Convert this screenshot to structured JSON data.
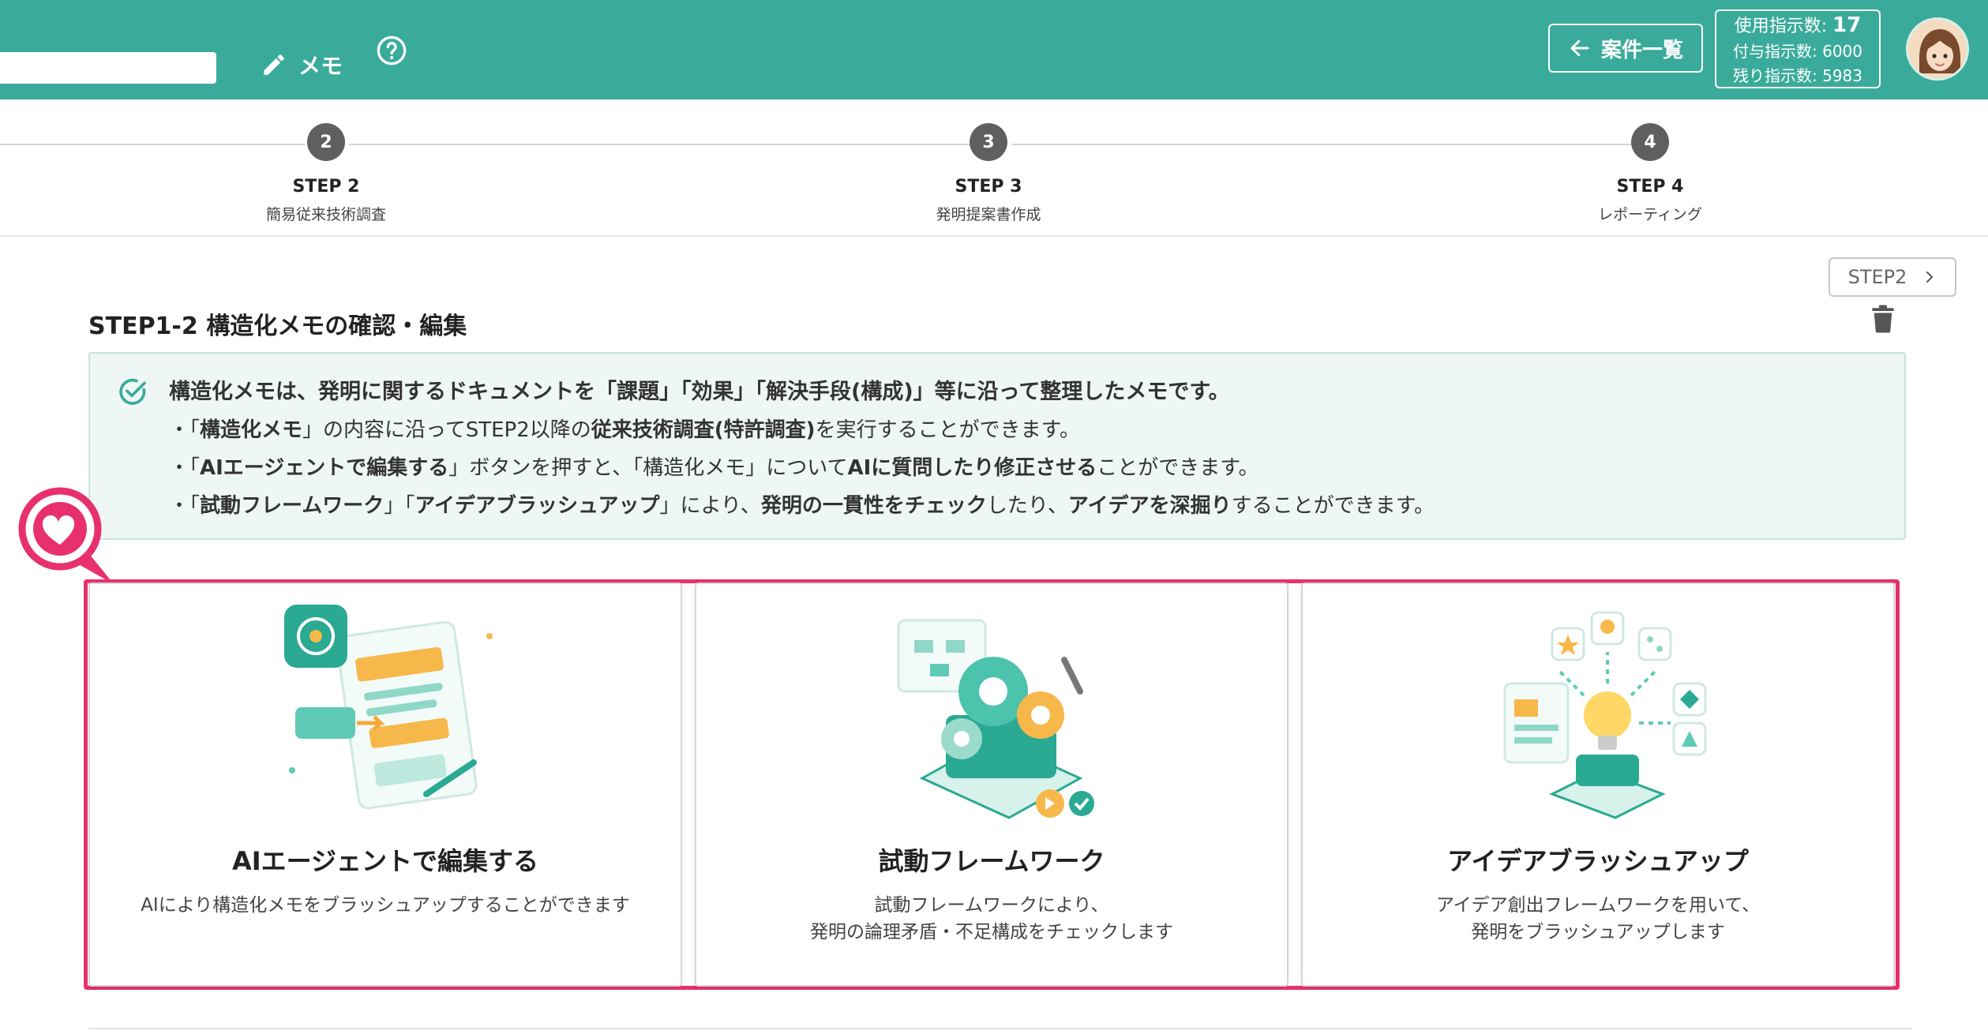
{
  "header": {
    "memo_label": "メモ",
    "back_label": "案件一覧",
    "usage": {
      "used_label": "使用指示数:",
      "used_value": "17",
      "granted_text": "付与指示数: 6000",
      "remaining_text": "残り指示数: 5983"
    }
  },
  "stepper": {
    "steps": [
      {
        "number": "2",
        "label": "STEP 2",
        "sub": "簡易従来技術調査"
      },
      {
        "number": "3",
        "label": "STEP 3",
        "sub": "発明提案書作成"
      },
      {
        "number": "4",
        "label": "STEP 4",
        "sub": "レポーティング"
      }
    ]
  },
  "content": {
    "next_label": "STEP2",
    "section_title": "STEP1-2 構造化メモの確認・編集",
    "info": {
      "headline": "構造化メモは、発明に関するドキュメントを「課題」「効果」「解決手段(構成)」等に沿って整理したメモです。",
      "line1": {
        "a": "・「",
        "b": "構造化メモ",
        "c": "」の内容に沿ってSTEP2以降の",
        "d": "従来技術調査(特許調査)",
        "e": "を実行することができます。"
      },
      "line2": {
        "a": "・「",
        "b": "AIエージェントで編集する",
        "c": "」ボタンを押すと、「構造化メモ」について",
        "d": "AIに質問したり修正させる",
        "e": "ことができます。"
      },
      "line3": {
        "a": "・「",
        "b": "試動フレームワーク",
        "c": "」「",
        "d": "アイデアブラッシュアップ",
        "e": "」により、",
        "f": "発明の一貫性をチェック",
        "g": "したり、",
        "h": "アイデアを深掘り",
        "i": "することができます。"
      }
    },
    "cards": [
      {
        "title": "AIエージェントで編集する",
        "desc1": "AIにより構造化メモをブラッシュアップすることができます",
        "desc2": ""
      },
      {
        "title": "試動フレームワーク",
        "desc1": "試動フレームワークにより、",
        "desc2": "発明の論理矛盾・不足構成をチェックします"
      },
      {
        "title": "アイデアブラッシュアップ",
        "desc1": "アイデア創出フレームワークを用いて、",
        "desc2": "発明をブラッシュアップします"
      }
    ]
  },
  "colors": {
    "header_bg": "#3aab9b",
    "info_bg": "#eef7f5",
    "highlight": "#e8306e",
    "step_circle": "#5f5f5f"
  },
  "icons": [
    "pencil-icon",
    "help-icon",
    "arrow-left-icon",
    "avatar",
    "chevron-right-icon",
    "trash-icon",
    "check-circle-icon",
    "heart-badge-icon"
  ]
}
